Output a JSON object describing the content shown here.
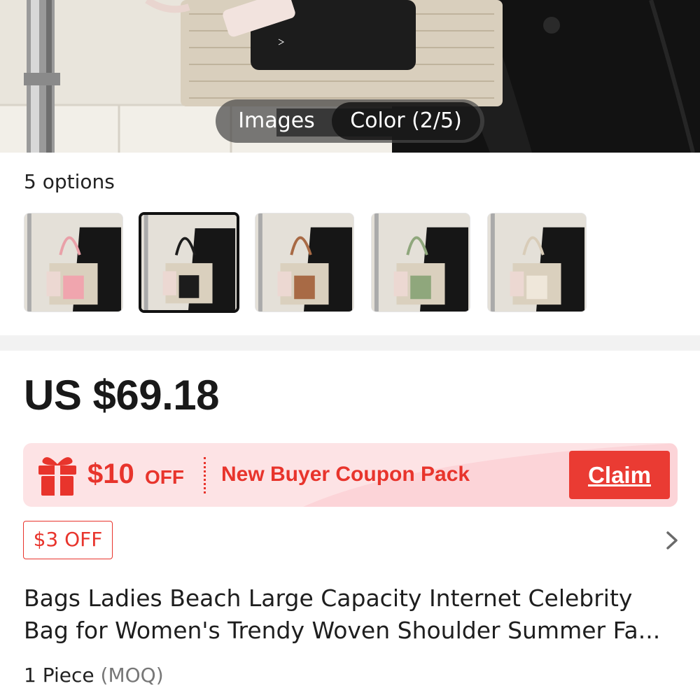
{
  "media_toggle": {
    "images_label": "Images",
    "color_label": "Color (2/5)"
  },
  "options": {
    "count_label": "5 options",
    "selected_index": 1,
    "variants": [
      {
        "icon": "bag-variant-pink-thumbnail",
        "accent": "#f0a5ae"
      },
      {
        "icon": "bag-variant-black-thumbnail",
        "accent": "#1c1c1c"
      },
      {
        "icon": "bag-variant-brown-thumbnail",
        "accent": "#a86a45"
      },
      {
        "icon": "bag-variant-green-thumbnail",
        "accent": "#8fa77c"
      },
      {
        "icon": "bag-variant-cream-thumbnail",
        "accent": "#efe7da"
      }
    ]
  },
  "price": "US $69.18",
  "coupon": {
    "amount": "$10",
    "off_label": "OFF",
    "text": "New Buyer Coupon Pack",
    "claim_label": "Claim",
    "icon": "gift-icon"
  },
  "discount_tag": "$3 OFF",
  "product": {
    "title_line1": "Bags Ladies Beach Large Capacity Internet Celebrity",
    "title_line2": "Bag for Women's Trendy Woven Shoulder Summer Fa...",
    "moq_quantity": "1 Piece",
    "moq_label": "(MOQ)"
  },
  "colors": {
    "accent_red": "#e8342c",
    "coupon_bg": "#fde3e5",
    "claim_bg": "#ea3b33",
    "price_text": "#191919"
  }
}
